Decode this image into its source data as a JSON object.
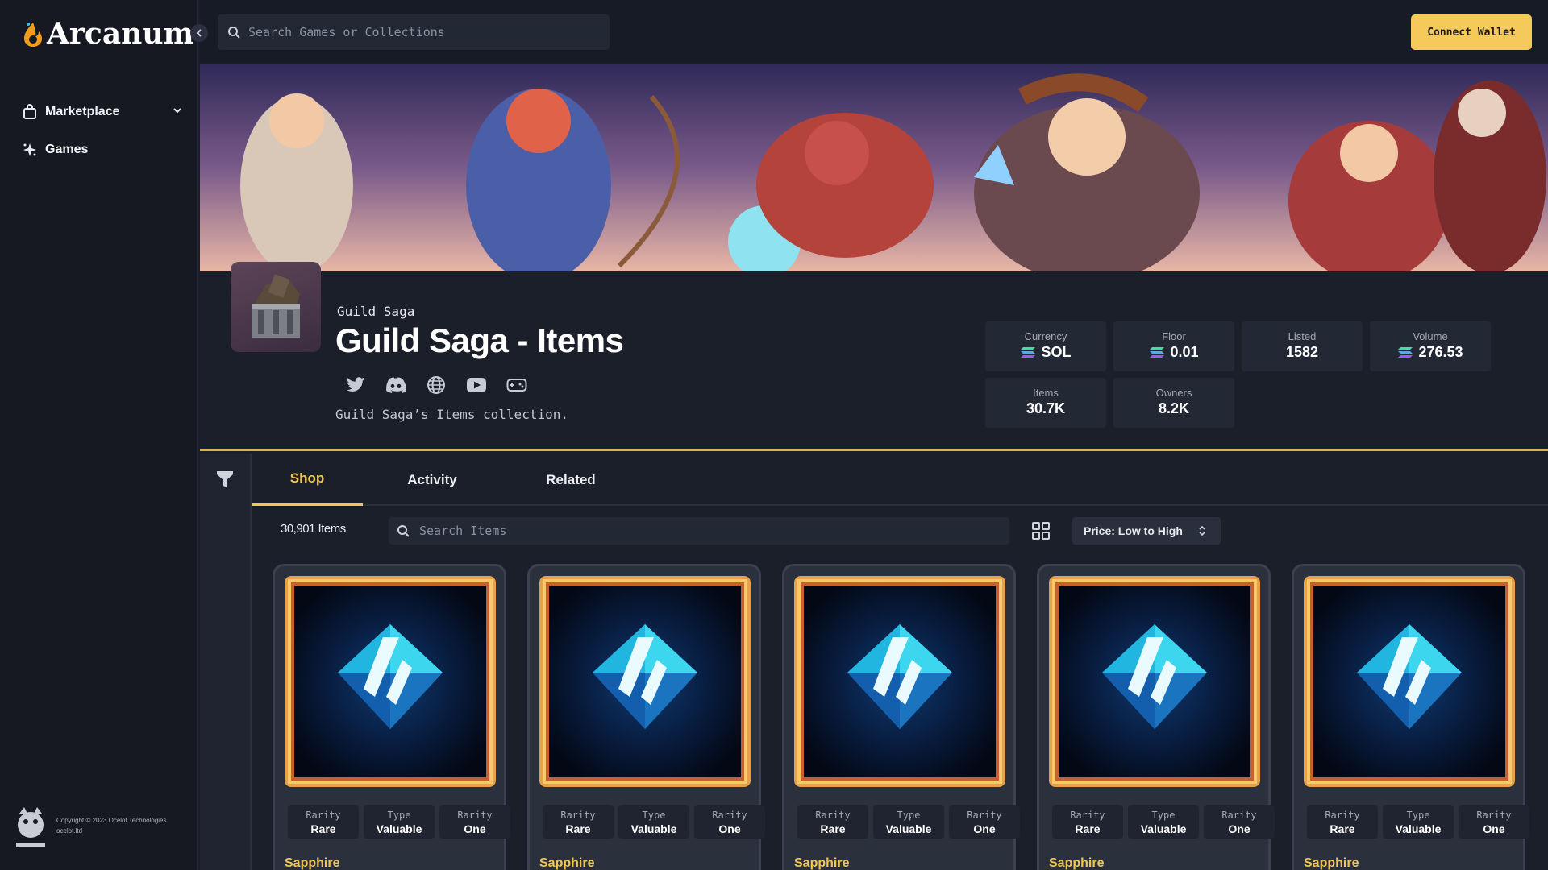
{
  "app": {
    "logo_text": "Arcanum"
  },
  "topbar": {
    "search_placeholder": "Search Games or Collections",
    "connect_label": "Connect Wallet"
  },
  "sidebar": {
    "items": [
      {
        "label": "Marketplace",
        "icon": "shopping-bag-icon"
      },
      {
        "label": "Games",
        "icon": "sparkle-icon"
      }
    ],
    "copyright": "Copyright © 2023 Ocelot Technologies ocelot.ltd"
  },
  "collection": {
    "game": "Guild Saga",
    "title": "Guild Saga - Items",
    "description": "Guild Saga’s Items collection.",
    "socials": [
      "twitter-icon",
      "discord-icon",
      "globe-icon",
      "youtube-icon",
      "gamepad-icon"
    ],
    "stats": [
      {
        "label": "Currency",
        "value": "SOL",
        "sol_icon": true
      },
      {
        "label": "Floor",
        "value": "0.01",
        "sol_icon": true
      },
      {
        "label": "Listed",
        "value": "1582",
        "sol_icon": false
      },
      {
        "label": "Volume",
        "value": "276.53",
        "sol_icon": true
      },
      {
        "label": "Items",
        "value": "30.7K",
        "sol_icon": false
      },
      {
        "label": "Owners",
        "value": "8.2K",
        "sol_icon": false
      }
    ]
  },
  "tabs": [
    {
      "label": "Shop",
      "active": true
    },
    {
      "label": "Activity",
      "active": false
    },
    {
      "label": "Related",
      "active": false
    }
  ],
  "toolbar": {
    "count": "30,901 Items",
    "search_placeholder": "Search Items",
    "sort_label": "Price: Low to High"
  },
  "cards": [
    {
      "name": "Sapphire",
      "attrs": [
        {
          "k": "Rarity",
          "v": "Rare"
        },
        {
          "k": "Type",
          "v": "Valuable"
        },
        {
          "k": "Rarity",
          "v": "One"
        }
      ]
    },
    {
      "name": "Sapphire",
      "attrs": [
        {
          "k": "Rarity",
          "v": "Rare"
        },
        {
          "k": "Type",
          "v": "Valuable"
        },
        {
          "k": "Rarity",
          "v": "One"
        }
      ]
    },
    {
      "name": "Sapphire",
      "attrs": [
        {
          "k": "Rarity",
          "v": "Rare"
        },
        {
          "k": "Type",
          "v": "Valuable"
        },
        {
          "k": "Rarity",
          "v": "One"
        }
      ]
    },
    {
      "name": "Sapphire",
      "attrs": [
        {
          "k": "Rarity",
          "v": "Rare"
        },
        {
          "k": "Type",
          "v": "Valuable"
        },
        {
          "k": "Rarity",
          "v": "One"
        }
      ]
    },
    {
      "name": "Sapphire",
      "attrs": [
        {
          "k": "Rarity",
          "v": "Rare"
        },
        {
          "k": "Type",
          "v": "Valuable"
        },
        {
          "k": "Rarity",
          "v": "One"
        }
      ]
    }
  ],
  "colors": {
    "accent": "#f0c552",
    "background": "#1b1f2a",
    "sidebar": "#161922",
    "card": "#2b303d"
  }
}
